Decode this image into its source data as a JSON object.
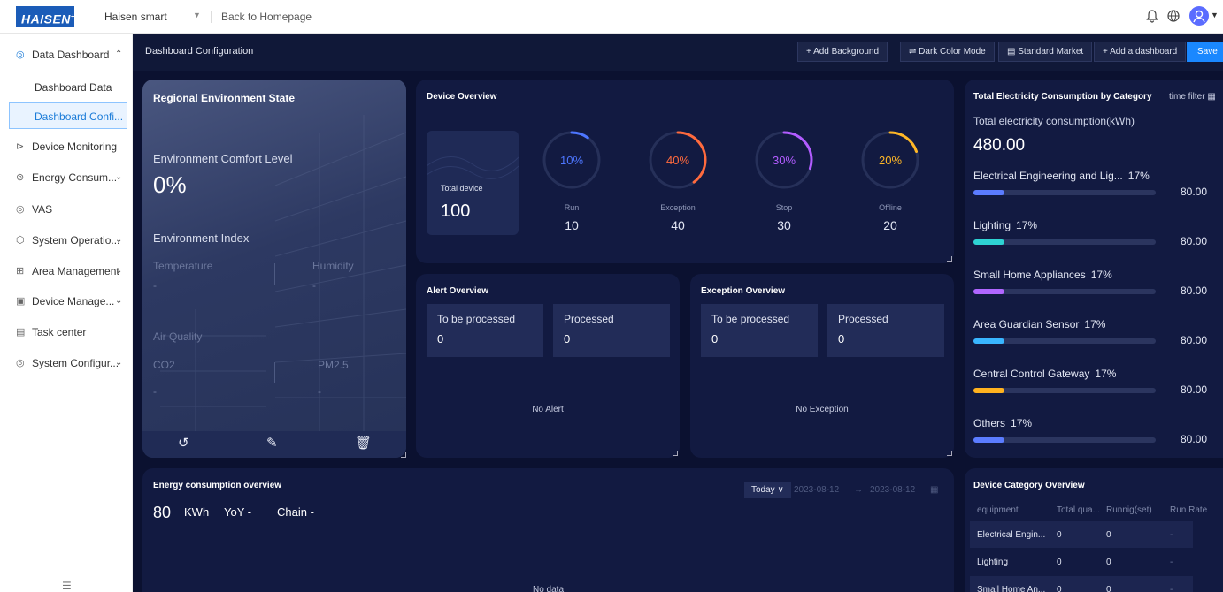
{
  "topbar": {
    "logo_text": "HAISEN",
    "logo_sup": "+",
    "tenant": "Haisen smart",
    "back_home": "Back to Homepage",
    "icons": [
      "bell-icon",
      "globe-icon",
      "user-avatar-icon"
    ]
  },
  "sidebar": {
    "items": [
      {
        "label": "Data Dashboard",
        "icon": "dashboard-icon",
        "expanded": true
      },
      {
        "label": "Dashboard Data"
      },
      {
        "label": "Dashboard Confi..."
      },
      {
        "label": "Device Monitoring",
        "icon": "monitor-icon"
      },
      {
        "label": "Energy Consum...",
        "icon": "energy-icon"
      },
      {
        "label": "VAS",
        "icon": "vas-icon"
      },
      {
        "label": "System Operatio...",
        "icon": "system-icon"
      },
      {
        "label": "Area Management",
        "icon": "area-icon"
      },
      {
        "label": "Device Manage...",
        "icon": "device-icon"
      },
      {
        "label": "Task center",
        "icon": "task-icon"
      },
      {
        "label": "System Configur...",
        "icon": "config-icon"
      }
    ]
  },
  "config_bar": {
    "title": "Dashboard Configuration",
    "buttons": {
      "add_background": "+ Add Background",
      "dark_mode": "⇌ Dark Color Mode",
      "standard_market": "▤ Standard Market",
      "add_dashboard": "+ Add a dashboard",
      "save": "Save"
    }
  },
  "regional": {
    "title": "Regional Environment State",
    "comfort_label": "Environment Comfort Level",
    "comfort_value": "0%",
    "index_label": "Environment Index",
    "temperature_label": "Temperature",
    "temperature_value": "-",
    "humidity_label": "Humidity",
    "humidity_value": "-",
    "air_quality_label": "Air Quality",
    "co2_label": "CO2",
    "co2_value": "-",
    "pm25_label": "PM2.5",
    "pm25_value": "-"
  },
  "device_overview": {
    "title": "Device Overview",
    "total_label": "Total device",
    "total_value": "100",
    "rings": [
      {
        "label": "Run",
        "value": "10",
        "percent_text": "10%",
        "fraction": 0.1,
        "color": "#4d76ff"
      },
      {
        "label": "Exception",
        "value": "40",
        "percent_text": "40%",
        "fraction": 0.4,
        "color": "#ff6a3d"
      },
      {
        "label": "Stop",
        "value": "30",
        "percent_text": "30%",
        "fraction": 0.3,
        "color": "#b25cff"
      },
      {
        "label": "Offline",
        "value": "20",
        "percent_text": "20%",
        "fraction": 0.2,
        "color": "#ffb726"
      }
    ]
  },
  "alert_overview": {
    "title": "Alert Overview",
    "to_be_processed_label": "To be processed",
    "to_be_processed_value": "0",
    "processed_label": "Processed",
    "processed_value": "0",
    "empty": "No Alert"
  },
  "exception_overview": {
    "title": "Exception Overview",
    "to_be_processed_label": "To be processed",
    "to_be_processed_value": "0",
    "processed_label": "Processed",
    "processed_value": "0",
    "empty": "No Exception"
  },
  "electricity": {
    "title": "Total Electricity Consumption by Category",
    "time_filter": "time filter ▦",
    "total_label": "Total electricity consumption(kWh)",
    "total_value": "480.00",
    "categories": [
      {
        "name": "Electrical Engineering and Lig...",
        "percent": "17%",
        "value": "80.00",
        "fraction": 0.17,
        "color": "#5b7cff"
      },
      {
        "name": "Lighting",
        "percent": "17%",
        "value": "80.00",
        "fraction": 0.17,
        "color": "#2ed3d3"
      },
      {
        "name": "Small Home Appliances",
        "percent": "17%",
        "value": "80.00",
        "fraction": 0.17,
        "color": "#b066ff"
      },
      {
        "name": "Area Guardian Sensor",
        "percent": "17%",
        "value": "80.00",
        "fraction": 0.17,
        "color": "#39b6ff"
      },
      {
        "name": "Central Control Gateway",
        "percent": "17%",
        "value": "80.00",
        "fraction": 0.17,
        "color": "#ffb21f"
      },
      {
        "name": "Others",
        "percent": "17%",
        "value": "80.00",
        "fraction": 0.17,
        "color": "#5b7cff"
      }
    ]
  },
  "energy_overview": {
    "title": "Energy consumption overview",
    "value": "80",
    "unit": "KWh",
    "yoy": "YoY -",
    "chain": "Chain -",
    "period": "Today ∨",
    "date_start": "2023-08-12",
    "date_arrow": "→",
    "date_end": "2023-08-12",
    "empty": "No data"
  },
  "device_category": {
    "title": "Device Category Overview",
    "headers": [
      "equipment",
      "Total qua...",
      "Runnig(set)",
      "Run Rate"
    ],
    "rows": [
      [
        "Electrical Engin...",
        "0",
        "0",
        "-"
      ],
      [
        "Lighting",
        "0",
        "0",
        "-"
      ],
      [
        "Small Home An...",
        "0",
        "0",
        "-"
      ]
    ]
  }
}
